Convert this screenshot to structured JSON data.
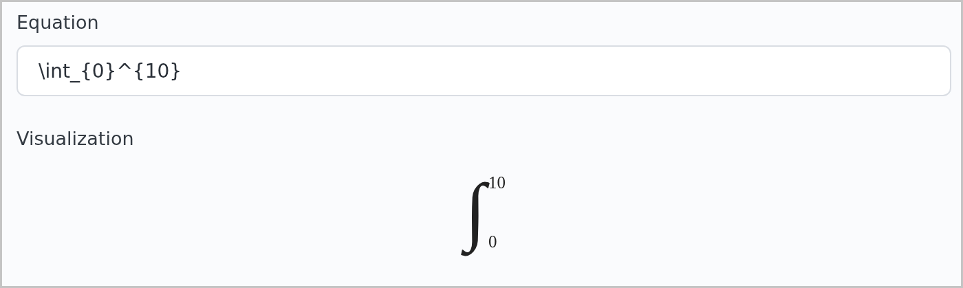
{
  "equation": {
    "label": "Equation",
    "value": "\\int_{0}^{10}"
  },
  "visualization": {
    "label": "Visualization",
    "symbol": "∫",
    "upper": "10",
    "lower": "0"
  }
}
